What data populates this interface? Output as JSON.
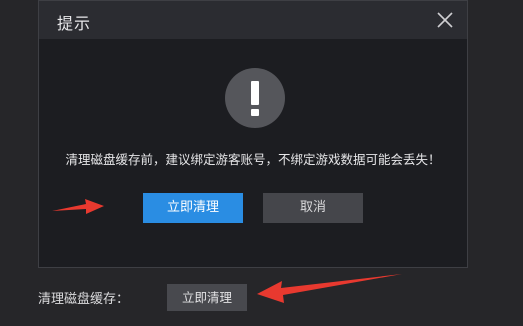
{
  "dialog": {
    "title": "提示",
    "message": "清理磁盘缓存前，建议绑定游客账号，不绑定游戏数据可能会丢失！",
    "confirm_label": "立即清理",
    "cancel_label": "取消",
    "icon": "exclamation-icon",
    "close_icon": "close-icon"
  },
  "settings": {
    "clear_cache_label": "清理磁盘缓存：",
    "clear_cache_button": "立即清理"
  },
  "colors": {
    "accent": "#2a8de3",
    "annotation_arrow": "#e8392f"
  }
}
